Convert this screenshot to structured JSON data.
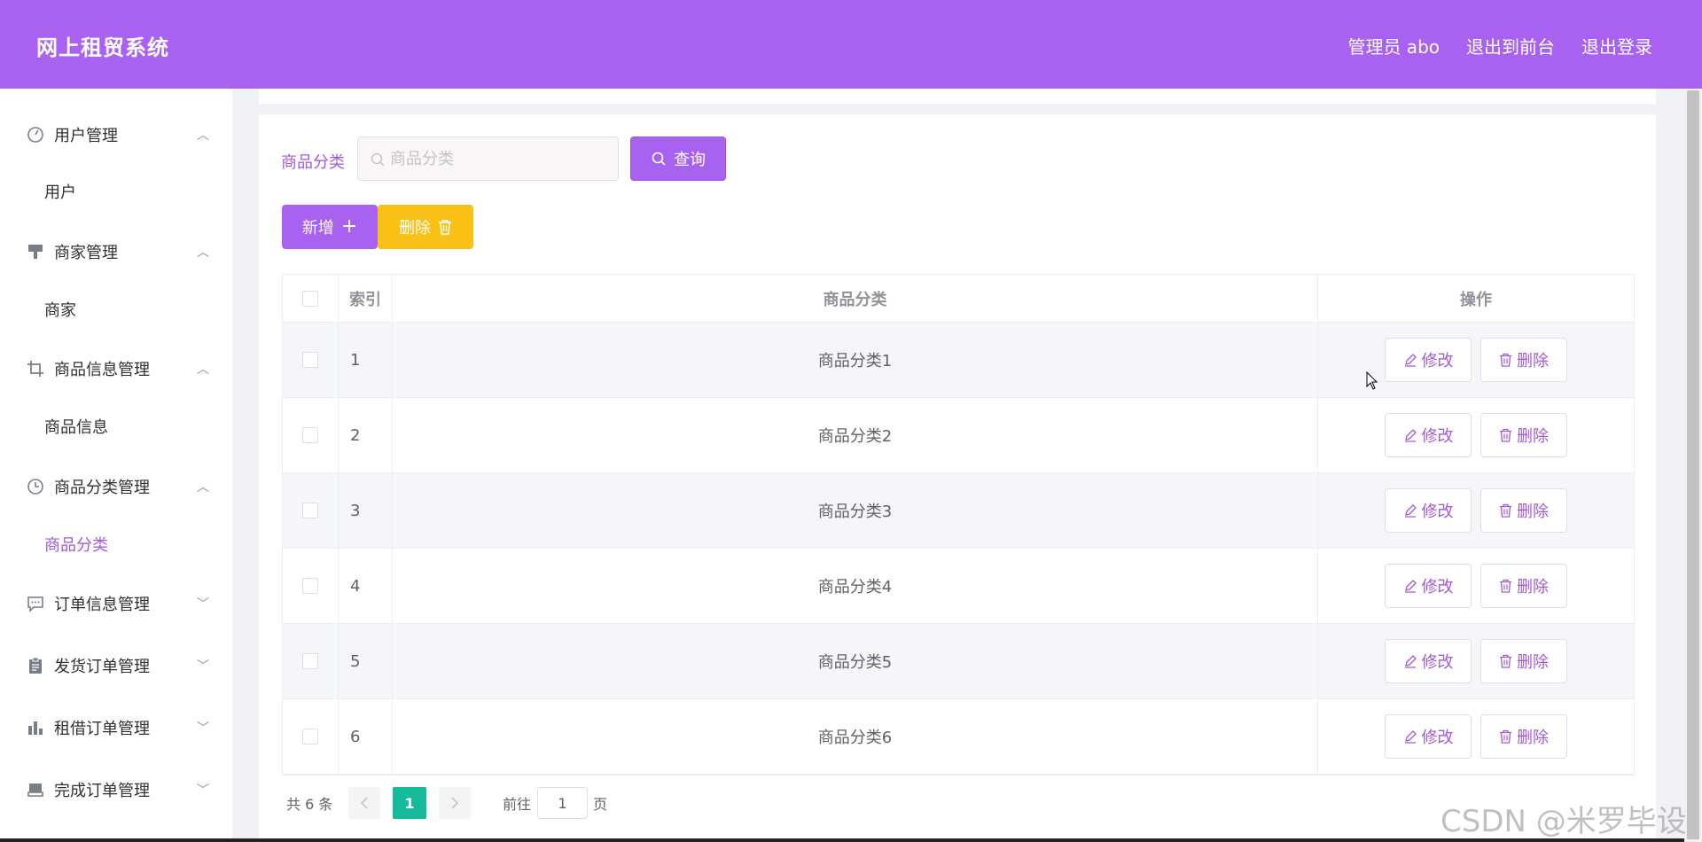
{
  "header": {
    "title": "网上租贸系统",
    "user": "管理员 abo",
    "back_front": "退出到前台",
    "logout": "退出登录"
  },
  "sidebar": {
    "groups": [
      {
        "label": "用户管理",
        "icon": "dashboard-icon",
        "expanded": true,
        "sub": "用户"
      },
      {
        "label": "商家管理",
        "icon": "brush-icon",
        "expanded": true,
        "sub": "商家"
      },
      {
        "label": "商品信息管理",
        "icon": "crop-icon",
        "expanded": true,
        "sub": "商品信息"
      },
      {
        "label": "商品分类管理",
        "icon": "clock-icon",
        "expanded": true,
        "sub": "商品分类"
      },
      {
        "label": "订单信息管理",
        "icon": "chat-icon",
        "expanded": false
      },
      {
        "label": "发货订单管理",
        "icon": "clipboard-icon",
        "expanded": false
      },
      {
        "label": "租借订单管理",
        "icon": "bar-chart-icon",
        "expanded": false
      },
      {
        "label": "完成订单管理",
        "icon": "box-icon",
        "expanded": false
      }
    ],
    "active_sub": "商品分类"
  },
  "filter": {
    "label": "商品分类",
    "placeholder": "商品分类",
    "query_label": "查询"
  },
  "toolbar": {
    "add_label": "新增",
    "delete_label": "删除"
  },
  "table": {
    "headers": {
      "index": "索引",
      "name": "商品分类",
      "ops": "操作"
    },
    "rows": [
      {
        "index": "1",
        "name": "商品分类1"
      },
      {
        "index": "2",
        "name": "商品分类2"
      },
      {
        "index": "3",
        "name": "商品分类3"
      },
      {
        "index": "4",
        "name": "商品分类4"
      },
      {
        "index": "5",
        "name": "商品分类5"
      },
      {
        "index": "6",
        "name": "商品分类6"
      }
    ],
    "edit_label": "修改",
    "delete_label": "删除"
  },
  "pagination": {
    "total": "共 6 条",
    "current": "1",
    "goto_label": "前往",
    "goto_value": "1",
    "unit": "页"
  },
  "watermark": "CSDN @米罗毕设",
  "colors": {
    "header_bg": "#a962f0",
    "accent": "#a25ad9",
    "delete_btn": "#f9c116",
    "page_active": "#16b99a"
  }
}
